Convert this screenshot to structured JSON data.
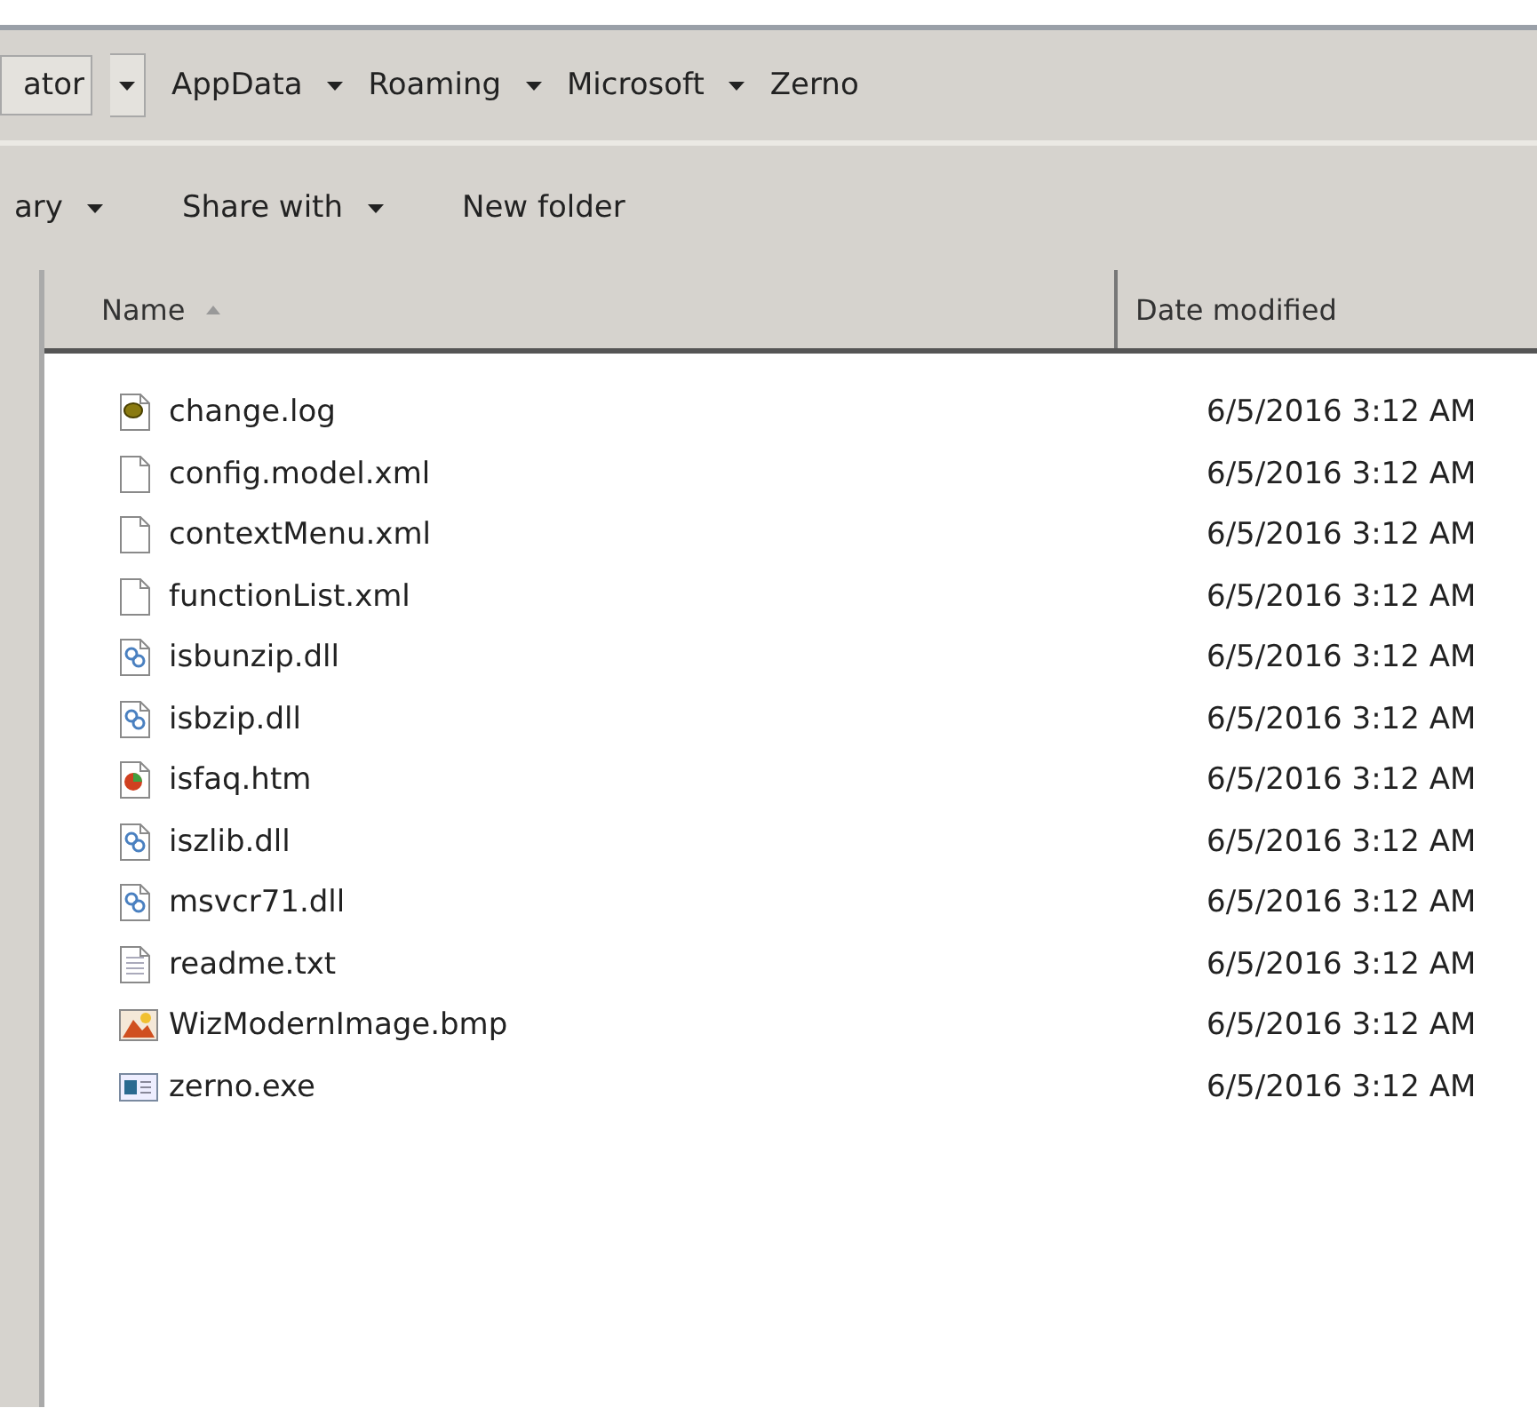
{
  "breadcrumb": [
    {
      "label": "ator"
    },
    {
      "label": "AppData"
    },
    {
      "label": "Roaming"
    },
    {
      "label": "Microsoft"
    },
    {
      "label": "Zerno"
    }
  ],
  "toolbar": [
    {
      "label": "ary",
      "dropdown": true
    },
    {
      "label": "Share with",
      "dropdown": true
    },
    {
      "label": "New folder",
      "dropdown": false
    }
  ],
  "columns": [
    {
      "label": "Name",
      "sorted": true
    },
    {
      "label": "Date modified",
      "sorted": false
    }
  ],
  "files": [
    {
      "name": "change.log",
      "kind": "log",
      "date": "6/5/2016 3:12 AM"
    },
    {
      "name": "config.model.xml",
      "kind": "blank",
      "date": "6/5/2016 3:12 AM"
    },
    {
      "name": "contextMenu.xml",
      "kind": "blank",
      "date": "6/5/2016 3:12 AM"
    },
    {
      "name": "functionList.xml",
      "kind": "blank",
      "date": "6/5/2016 3:12 AM"
    },
    {
      "name": "isbunzip.dll",
      "kind": "dll",
      "date": "6/5/2016 3:12 AM"
    },
    {
      "name": "isbzip.dll",
      "kind": "dll",
      "date": "6/5/2016 3:12 AM"
    },
    {
      "name": "isfaq.htm",
      "kind": "htm",
      "date": "6/5/2016 3:12 AM"
    },
    {
      "name": "iszlib.dll",
      "kind": "dll",
      "date": "6/5/2016 3:12 AM"
    },
    {
      "name": "msvcr71.dll",
      "kind": "dll",
      "date": "6/5/2016 3:12 AM"
    },
    {
      "name": "readme.txt",
      "kind": "txt",
      "date": "6/5/2016 3:12 AM"
    },
    {
      "name": "WizModernImage.bmp",
      "kind": "bmp",
      "date": "6/5/2016 3:12 AM"
    },
    {
      "name": "zerno.exe",
      "kind": "exe",
      "date": "6/5/2016 3:12 AM"
    }
  ]
}
